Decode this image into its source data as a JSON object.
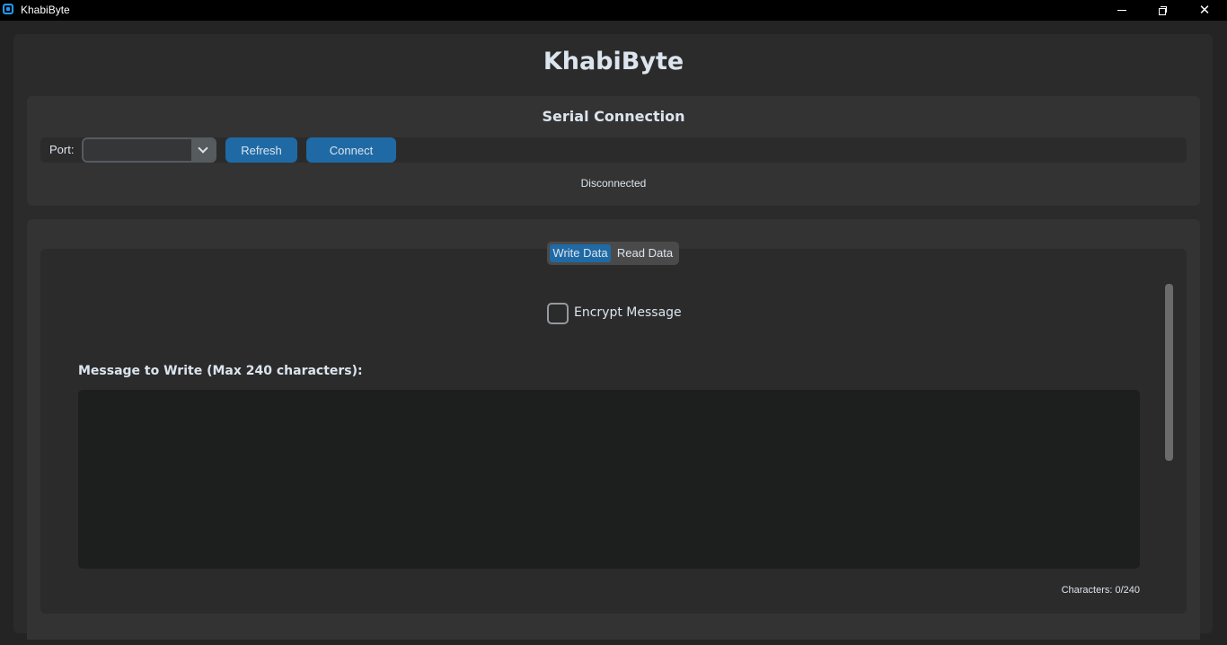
{
  "window": {
    "title": "KhabiByte",
    "minimize_icon": "minimize-icon",
    "restore_icon": "restore-icon",
    "close_icon": "close-icon",
    "close_glyph": "✕"
  },
  "app": {
    "title": "KhabiByte"
  },
  "serial": {
    "title": "Serial Connection",
    "port_label": "Port:",
    "port_value": "",
    "refresh_label": "Refresh",
    "connect_label": "Connect",
    "status": "Disconnected"
  },
  "tabs": [
    {
      "label": "Write Data",
      "active": true
    },
    {
      "label": "Read Data",
      "active": false
    }
  ],
  "write": {
    "encrypt_label": "Encrypt Message",
    "encrypt_checked": false,
    "message_label": "Message to Write (Max 240 characters):",
    "message_value": "",
    "char_count": "Characters: 0/240"
  },
  "colors": {
    "accent": "#1f6aa5",
    "background": "#242424",
    "frame": "#2b2b2b",
    "panel": "#333333",
    "text": "#dce4ee"
  }
}
